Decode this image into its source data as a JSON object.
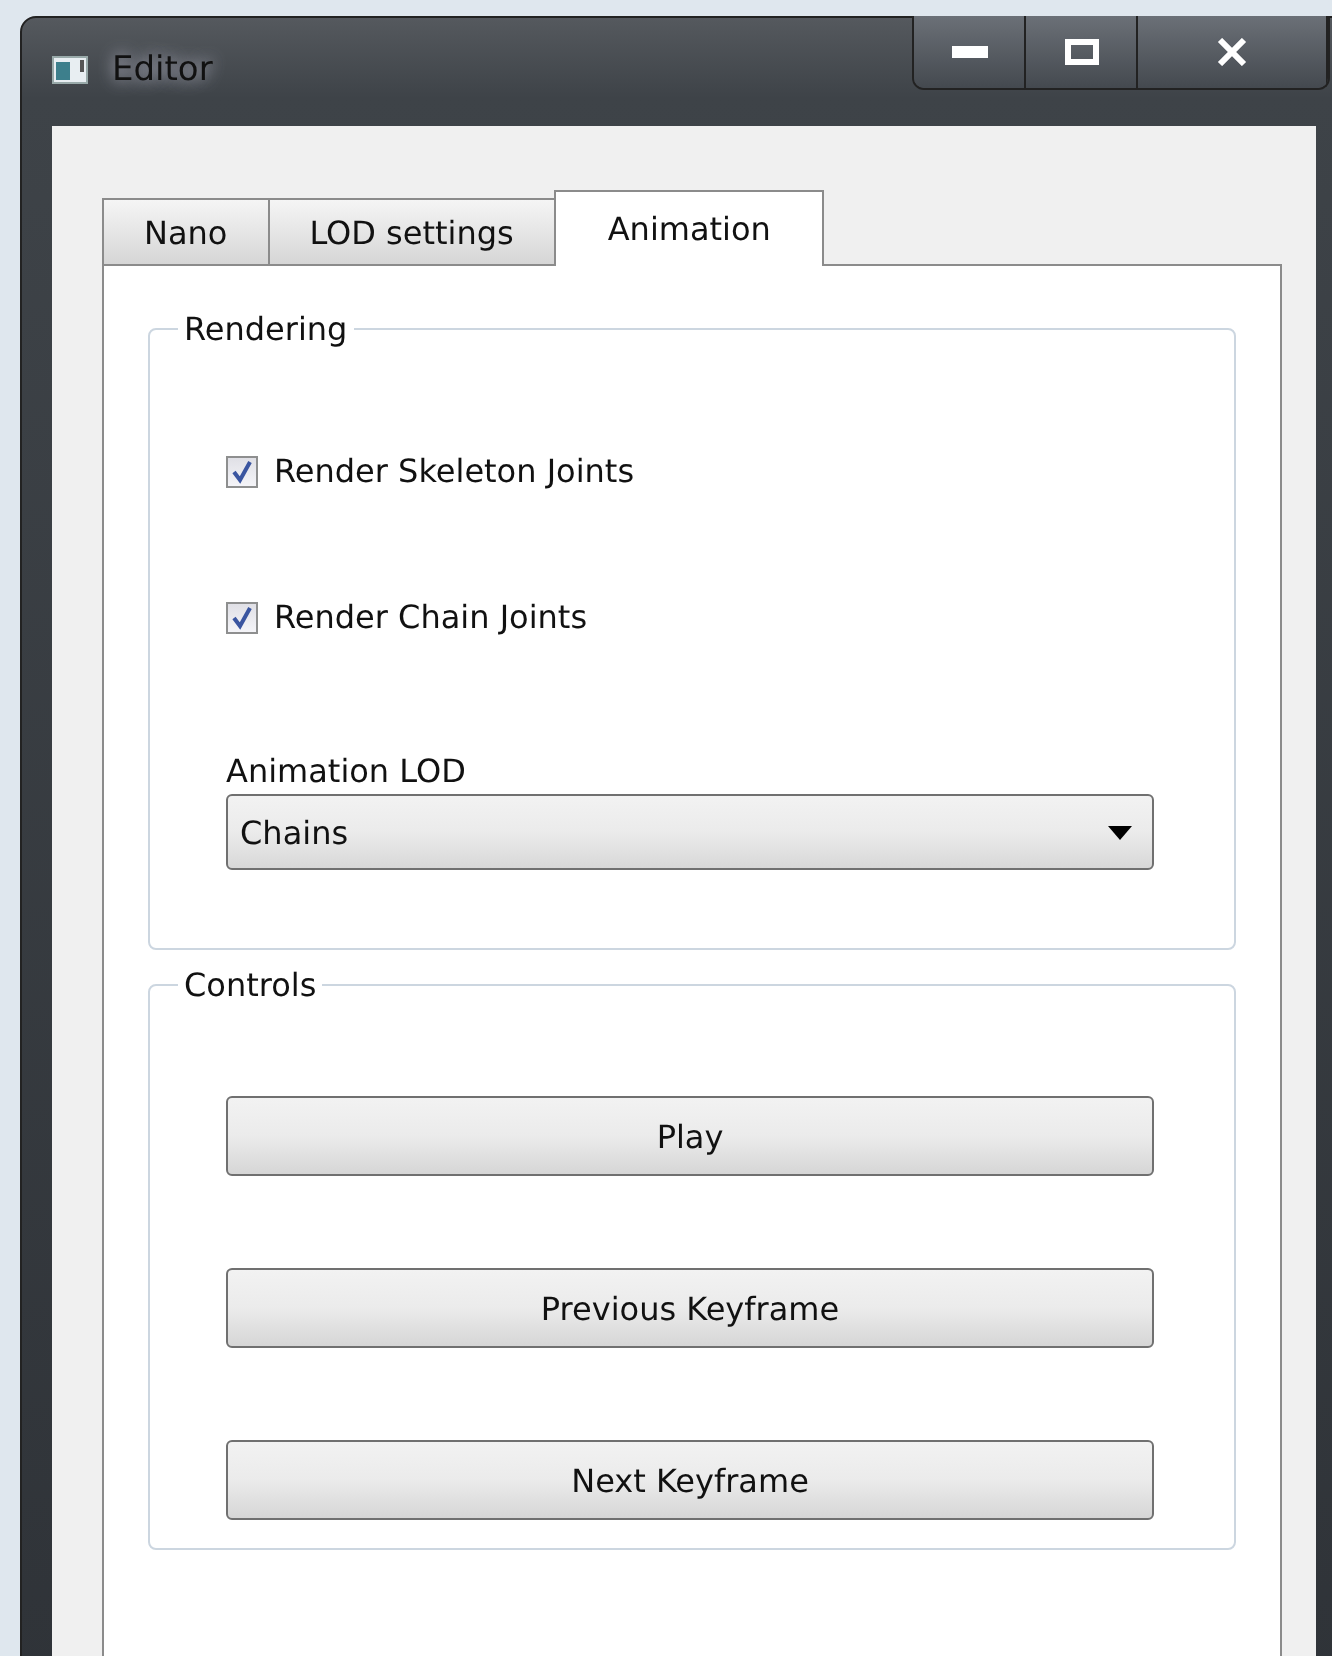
{
  "window": {
    "title": "Editor"
  },
  "tabs": [
    {
      "label": "Nano",
      "selected": false
    },
    {
      "label": "LOD settings",
      "selected": false
    },
    {
      "label": "Animation",
      "selected": true
    }
  ],
  "rendering": {
    "title": "Rendering",
    "checkboxes": [
      {
        "label": "Render Skeleton Joints",
        "checked": true
      },
      {
        "label": "Render Chain Joints",
        "checked": true
      }
    ],
    "animation_lod": {
      "label": "Animation LOD",
      "value": "Chains"
    }
  },
  "controls": {
    "title": "Controls",
    "buttons": [
      "Play",
      "Previous Keyframe",
      "Next Keyframe"
    ]
  }
}
